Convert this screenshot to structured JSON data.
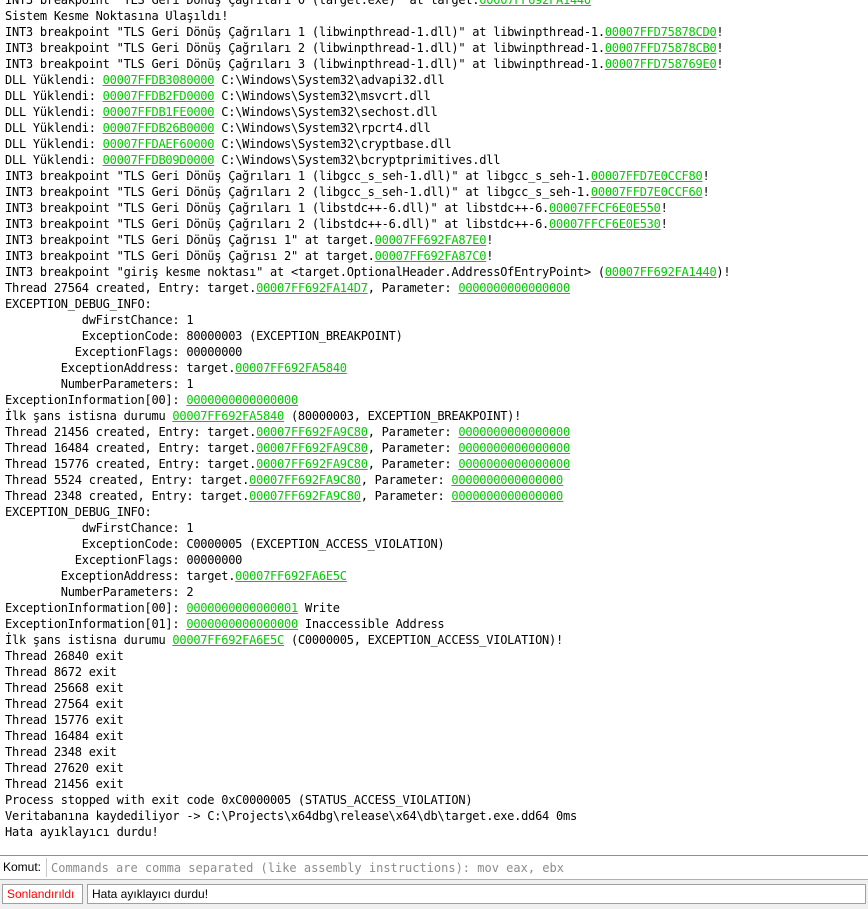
{
  "colors": {
    "address": "#00cc00",
    "status_stopped": "#ff0000"
  },
  "log": [
    [
      {
        "t": "INT3 breakpoint \"TLS Geri Dönüş Çağrıları 0 (target.exe)\" at target."
      },
      {
        "a": "00007FF692FA1440"
      }
    ],
    [
      {
        "t": "Sistem Kesme Noktasına Ulaşıldı!"
      }
    ],
    [
      {
        "t": "INT3 breakpoint \"TLS Geri Dönüş Çağrıları 1 (libwinpthread-1.dll)\" at libwinpthread-1."
      },
      {
        "a": "00007FFD75878CD0"
      },
      {
        "t": "!"
      }
    ],
    [
      {
        "t": "INT3 breakpoint \"TLS Geri Dönüş Çağrıları 2 (libwinpthread-1.dll)\" at libwinpthread-1."
      },
      {
        "a": "00007FFD75878CB0"
      },
      {
        "t": "!"
      }
    ],
    [
      {
        "t": "INT3 breakpoint \"TLS Geri Dönüş Çağrıları 3 (libwinpthread-1.dll)\" at libwinpthread-1."
      },
      {
        "a": "00007FFD758769E0"
      },
      {
        "t": "!"
      }
    ],
    [
      {
        "t": "DLL Yüklendi: "
      },
      {
        "a": "00007FFDB3080000"
      },
      {
        "t": " C:\\Windows\\System32\\advapi32.dll"
      }
    ],
    [
      {
        "t": "DLL Yüklendi: "
      },
      {
        "a": "00007FFDB2FD0000"
      },
      {
        "t": " C:\\Windows\\System32\\msvcrt.dll"
      }
    ],
    [
      {
        "t": "DLL Yüklendi: "
      },
      {
        "a": "00007FFDB1FE0000"
      },
      {
        "t": " C:\\Windows\\System32\\sechost.dll"
      }
    ],
    [
      {
        "t": "DLL Yüklendi: "
      },
      {
        "a": "00007FFDB26B0000"
      },
      {
        "t": " C:\\Windows\\System32\\rpcrt4.dll"
      }
    ],
    [
      {
        "t": "DLL Yüklendi: "
      },
      {
        "a": "00007FFDAEF60000"
      },
      {
        "t": " C:\\Windows\\System32\\cryptbase.dll"
      }
    ],
    [
      {
        "t": "DLL Yüklendi: "
      },
      {
        "a": "00007FFDB09D0000"
      },
      {
        "t": " C:\\Windows\\System32\\bcryptprimitives.dll"
      }
    ],
    [
      {
        "t": "INT3 breakpoint \"TLS Geri Dönüş Çağrıları 1 (libgcc_s_seh-1.dll)\" at libgcc_s_seh-1."
      },
      {
        "a": "00007FFD7E0CCF80"
      },
      {
        "t": "!"
      }
    ],
    [
      {
        "t": "INT3 breakpoint \"TLS Geri Dönüş Çağrıları 2 (libgcc_s_seh-1.dll)\" at libgcc_s_seh-1."
      },
      {
        "a": "00007FFD7E0CCF60"
      },
      {
        "t": "!"
      }
    ],
    [
      {
        "t": "INT3 breakpoint \"TLS Geri Dönüş Çağrıları 1 (libstdc++-6.dll)\" at libstdc++-6."
      },
      {
        "a": "00007FFCF6E0E550"
      },
      {
        "t": "!"
      }
    ],
    [
      {
        "t": "INT3 breakpoint \"TLS Geri Dönüş Çağrıları 2 (libstdc++-6.dll)\" at libstdc++-6."
      },
      {
        "a": "00007FFCF6E0E530"
      },
      {
        "t": "!"
      }
    ],
    [
      {
        "t": "INT3 breakpoint \"TLS Geri Dönüş Çağrısı 1\" at target."
      },
      {
        "a": "00007FF692FA87E0"
      },
      {
        "t": "!"
      }
    ],
    [
      {
        "t": "INT3 breakpoint \"TLS Geri Dönüş Çağrısı 2\" at target."
      },
      {
        "a": "00007FF692FA87C0"
      },
      {
        "t": "!"
      }
    ],
    [
      {
        "t": "INT3 breakpoint \"giriş kesme noktası\" at <target.OptionalHeader.AddressOfEntryPoint> ("
      },
      {
        "a": "00007FF692FA1440"
      },
      {
        "t": ")!"
      }
    ],
    [
      {
        "t": "Thread 27564 created, Entry: target."
      },
      {
        "a": "00007FF692FA14D7"
      },
      {
        "t": ", Parameter: "
      },
      {
        "a": "0000000000000000"
      }
    ],
    [
      {
        "t": "EXCEPTION_DEBUG_INFO:"
      }
    ],
    [
      {
        "t": "           dwFirstChance: 1"
      }
    ],
    [
      {
        "t": "           ExceptionCode: 80000003 (EXCEPTION_BREAKPOINT)"
      }
    ],
    [
      {
        "t": "          ExceptionFlags: 00000000"
      }
    ],
    [
      {
        "t": "        ExceptionAddress: target."
      },
      {
        "a": "00007FF692FA5840"
      }
    ],
    [
      {
        "t": "        NumberParameters: 1"
      }
    ],
    [
      {
        "t": "ExceptionInformation[00]: "
      },
      {
        "a": "0000000000000000"
      }
    ],
    [
      {
        "t": "İlk şans istisna durumu "
      },
      {
        "a": "00007FF692FA5840"
      },
      {
        "t": " (80000003, EXCEPTION_BREAKPOINT)!"
      }
    ],
    [
      {
        "t": "Thread 21456 created, Entry: target."
      },
      {
        "a": "00007FF692FA9C80"
      },
      {
        "t": ", Parameter: "
      },
      {
        "a": "0000000000000000"
      }
    ],
    [
      {
        "t": "Thread 16484 created, Entry: target."
      },
      {
        "a": "00007FF692FA9C80"
      },
      {
        "t": ", Parameter: "
      },
      {
        "a": "0000000000000000"
      }
    ],
    [
      {
        "t": "Thread 15776 created, Entry: target."
      },
      {
        "a": "00007FF692FA9C80"
      },
      {
        "t": ", Parameter: "
      },
      {
        "a": "0000000000000000"
      }
    ],
    [
      {
        "t": "Thread 5524 created, Entry: target."
      },
      {
        "a": "00007FF692FA9C80"
      },
      {
        "t": ", Parameter: "
      },
      {
        "a": "0000000000000000"
      }
    ],
    [
      {
        "t": "Thread 2348 created, Entry: target."
      },
      {
        "a": "00007FF692FA9C80"
      },
      {
        "t": ", Parameter: "
      },
      {
        "a": "0000000000000000"
      }
    ],
    [
      {
        "t": "EXCEPTION_DEBUG_INFO:"
      }
    ],
    [
      {
        "t": "           dwFirstChance: 1"
      }
    ],
    [
      {
        "t": "           ExceptionCode: C0000005 (EXCEPTION_ACCESS_VIOLATION)"
      }
    ],
    [
      {
        "t": "          ExceptionFlags: 00000000"
      }
    ],
    [
      {
        "t": "        ExceptionAddress: target."
      },
      {
        "a": "00007FF692FA6E5C"
      }
    ],
    [
      {
        "t": "        NumberParameters: 2"
      }
    ],
    [
      {
        "t": "ExceptionInformation[00]: "
      },
      {
        "a": "0000000000000001"
      },
      {
        "t": " Write"
      }
    ],
    [
      {
        "t": "ExceptionInformation[01]: "
      },
      {
        "a": "0000000000000000"
      },
      {
        "t": " Inaccessible Address"
      }
    ],
    [
      {
        "t": "İlk şans istisna durumu "
      },
      {
        "a": "00007FF692FA6E5C"
      },
      {
        "t": " (C0000005, EXCEPTION_ACCESS_VIOLATION)!"
      }
    ],
    [
      {
        "t": "Thread 26840 exit"
      }
    ],
    [
      {
        "t": "Thread 8672 exit"
      }
    ],
    [
      {
        "t": "Thread 25668 exit"
      }
    ],
    [
      {
        "t": "Thread 27564 exit"
      }
    ],
    [
      {
        "t": "Thread 15776 exit"
      }
    ],
    [
      {
        "t": "Thread 16484 exit"
      }
    ],
    [
      {
        "t": "Thread 2348 exit"
      }
    ],
    [
      {
        "t": "Thread 27620 exit"
      }
    ],
    [
      {
        "t": "Thread 21456 exit"
      }
    ],
    [
      {
        "t": "Process stopped with exit code 0xC0000005 (STATUS_ACCESS_VIOLATION)"
      }
    ],
    [
      {
        "t": "Veritabanına kaydediliyor -> C:\\Projects\\x64dbg\\release\\x64\\db\\target.exe.dd64 0ms"
      }
    ],
    [
      {
        "t": "Hata ayıklayıcı durdu!"
      }
    ]
  ],
  "command": {
    "label": "Komut:",
    "value": "",
    "placeholder": "Commands are comma separated (like assembly instructions): mov eax, ebx"
  },
  "status": {
    "state": "Sonlandırıldı",
    "message": "Hata ayıklayıcı durdu!"
  }
}
